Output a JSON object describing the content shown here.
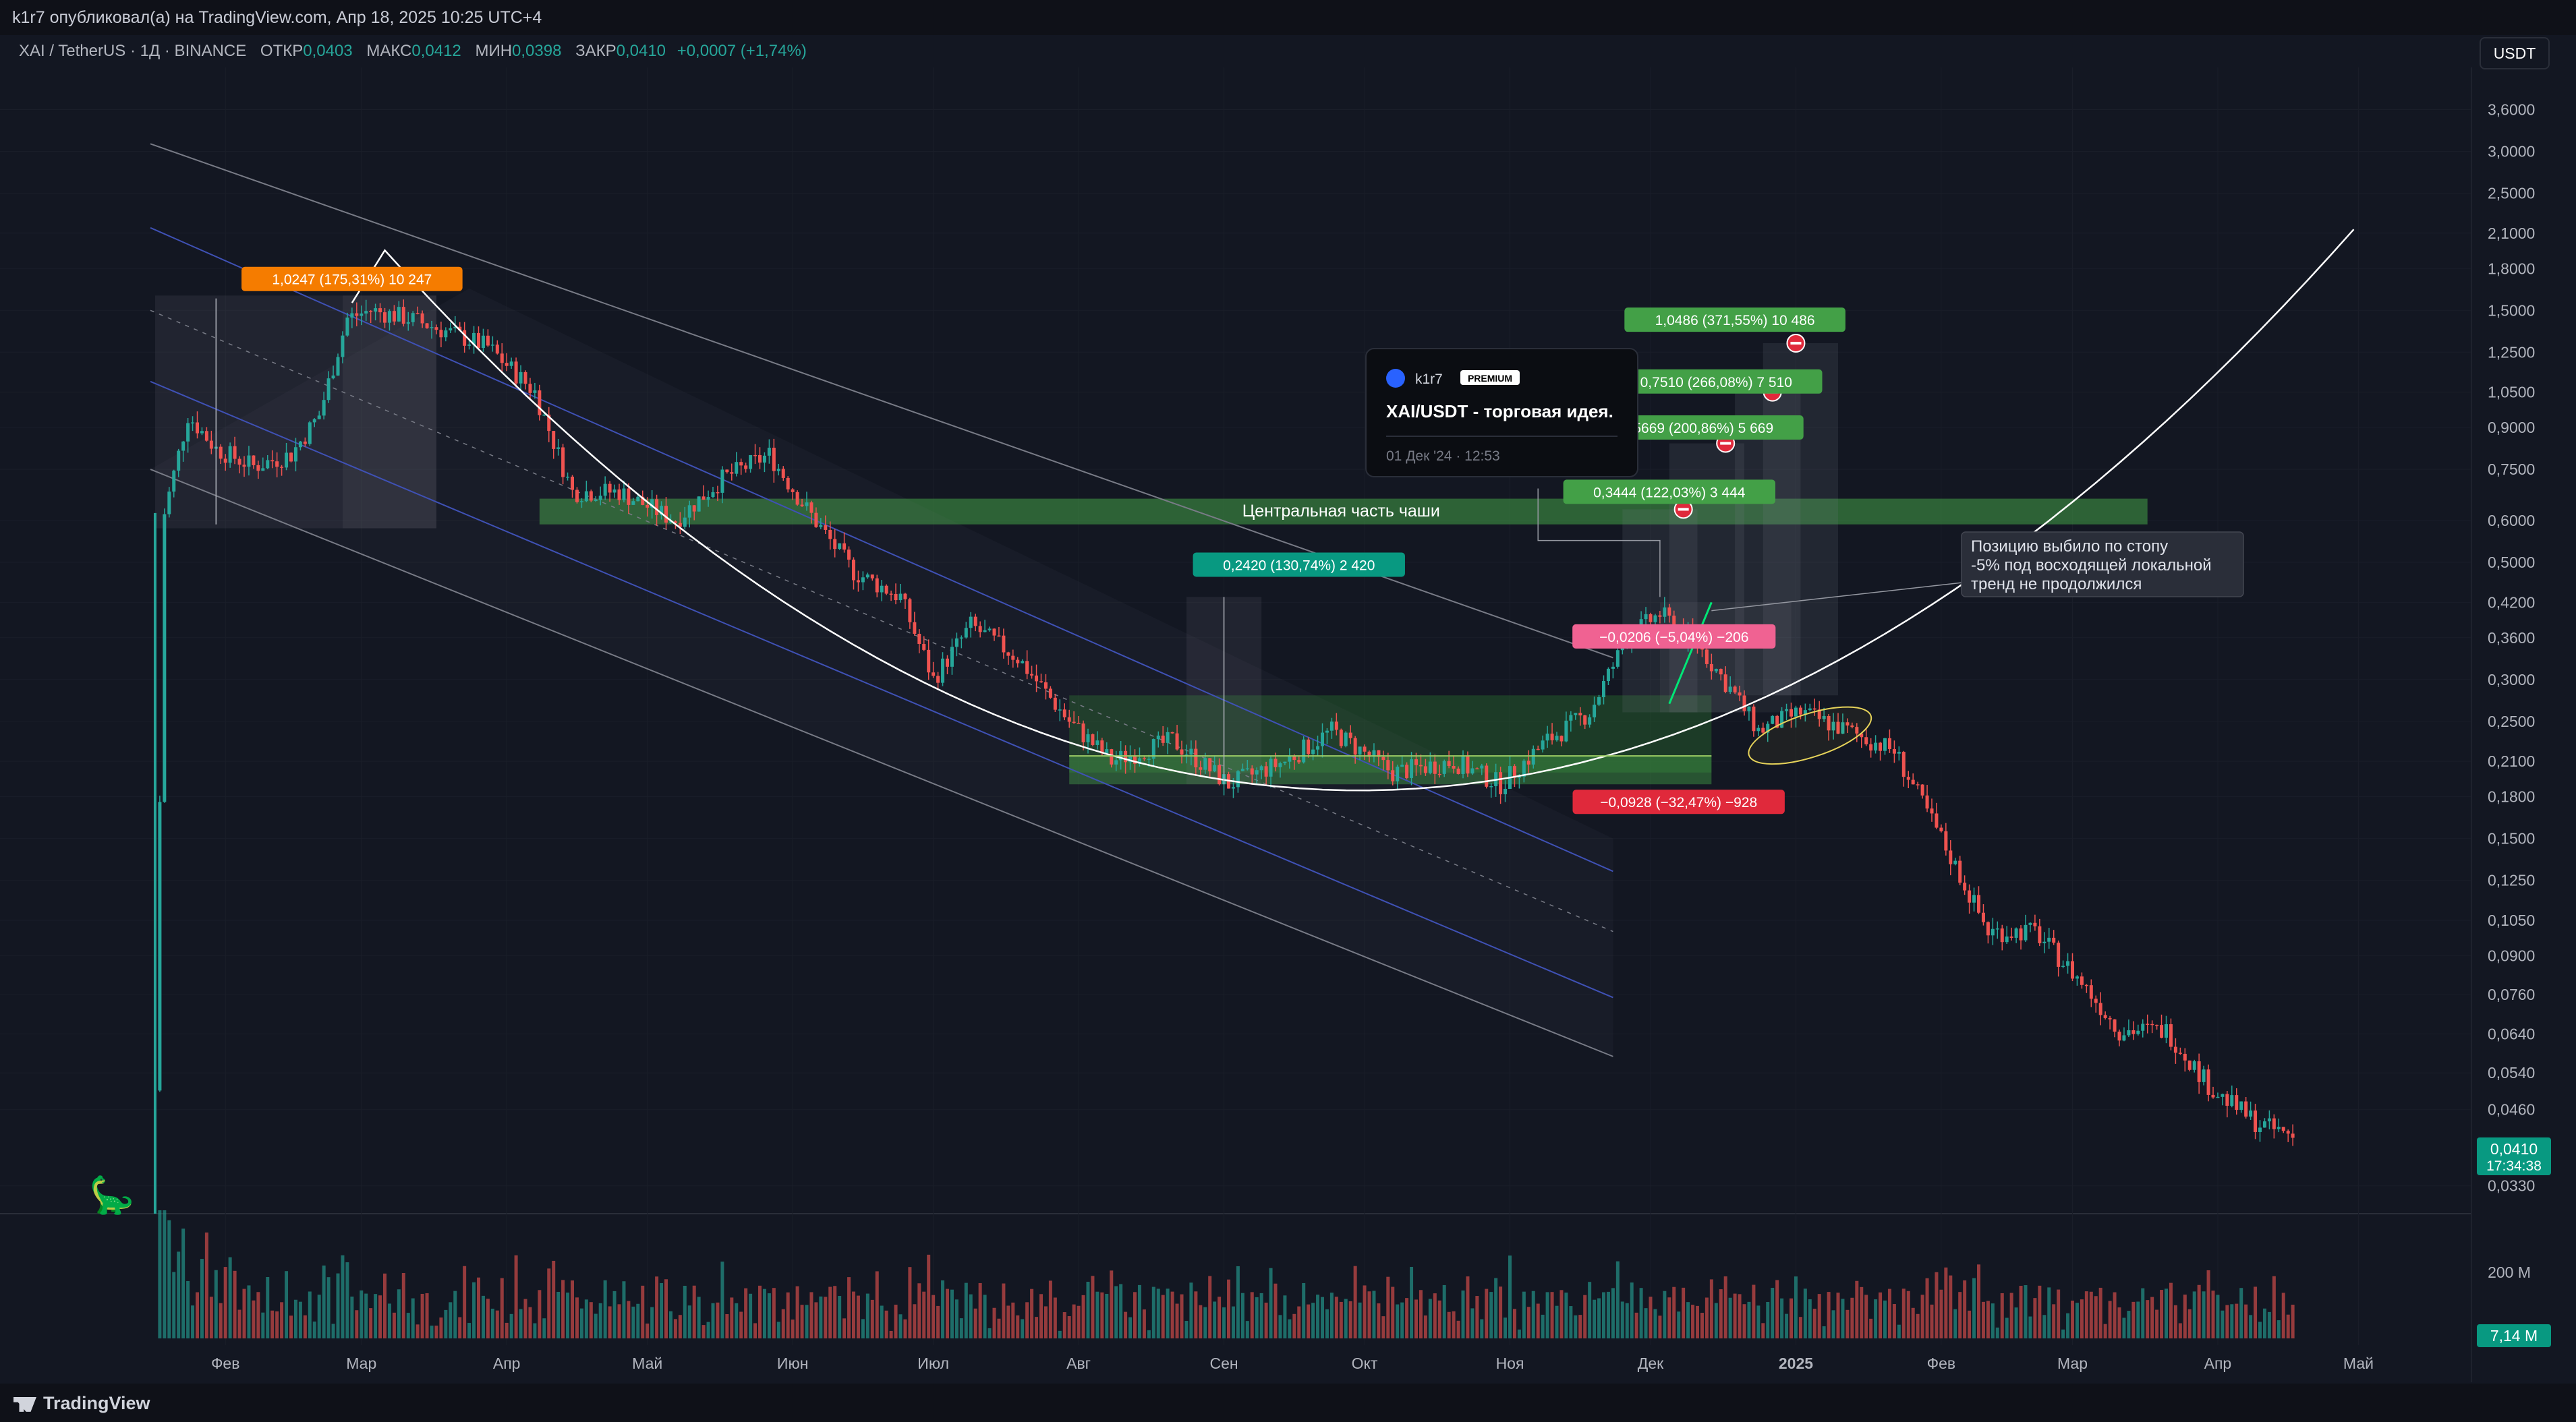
{
  "header": {
    "publish": "k1r7 опубликовал(а) на TradingView.com, Апр 18, 2025 10:25 UTC+4"
  },
  "symbol": {
    "name": "XAI / TetherUS · 1Д · BINANCE",
    "o_label": "ОТКР",
    "o": "0,0403",
    "h_label": "МАКС",
    "h": "0,0412",
    "l_label": "МИН",
    "l": "0,0398",
    "c_label": "ЗАКР",
    "c": "0,0410",
    "chg": "+0,0007 (+1,74%)"
  },
  "currency_button": "USDT",
  "footer": {
    "brand": "TradingView"
  },
  "colors": {
    "bg": "#131722",
    "up": "#26a69a",
    "down": "#ef5350",
    "green_label": "#43a047",
    "red_label": "#e0293b",
    "orange_label": "#f57c00",
    "teal_label": "#089981",
    "zone": "#2e7d32"
  },
  "idea_card": {
    "author": "k1r7",
    "badge": "PREMIUM",
    "title": "XAI/USDT - торговая идея.",
    "date": "01 Дек '24 · 12:53"
  },
  "note": {
    "line1": "Позицию выбило по стопу",
    "line2": "-5% под восходящей локальной",
    "line3": "тренд не продолжился"
  },
  "zone_label": "Центральная часть чаши",
  "measure_labels": [
    {
      "text": "1,0247 (175,31%) 10 247",
      "color": "orange"
    },
    {
      "text": "0,2420 (130,74%) 2 420",
      "color": "teal"
    },
    {
      "text": "−0,0928 (−32,47%) −928",
      "color": "red"
    },
    {
      "text": "−0,0206 (−5,04%) −206",
      "color": "pink"
    },
    {
      "text": "0,3444 (122,03%) 3 444",
      "color": "green"
    },
    {
      "text": "0,5669 (200,86%) 5 669",
      "color": "green"
    },
    {
      "text": "0,7510 (266,08%) 7 510",
      "color": "green"
    },
    {
      "text": "1,0486 (371,55%) 10 486",
      "color": "green"
    }
  ],
  "price_badge": {
    "price": "0,0410",
    "countdown": "17:34:38"
  },
  "volume_badge": "7,14 M",
  "volume_tick": "200 M",
  "chart_data": {
    "type": "candlestick",
    "scale": "log",
    "ylim": [
      0.031,
      4.2
    ],
    "y_ticks": [
      "3,6000",
      "3,0000",
      "2,5000",
      "2,1000",
      "1,8000",
      "1,5000",
      "1,2500",
      "1,0500",
      "0,9000",
      "0,7500",
      "0,6000",
      "0,5000",
      "0,4200",
      "0,3600",
      "0,3000",
      "0,2500",
      "0,2100",
      "0,1800",
      "0,1500",
      "0,1250",
      "0,1050",
      "0,0900",
      "0,0760",
      "0,0640",
      "0,0540",
      "0,0460",
      "0,0330"
    ],
    "y_tick_values": [
      3.6,
      3.0,
      2.5,
      2.1,
      1.8,
      1.5,
      1.25,
      1.05,
      0.9,
      0.75,
      0.6,
      0.5,
      0.42,
      0.36,
      0.3,
      0.25,
      0.21,
      0.18,
      0.15,
      0.125,
      0.105,
      0.09,
      0.076,
      0.064,
      0.054,
      0.046,
      0.033
    ],
    "x_ticks": [
      "Фев",
      "Мар",
      "Апр",
      "Май",
      "Июн",
      "Июл",
      "Авг",
      "Сен",
      "Окт",
      "Ноя",
      "Дек",
      "2025",
      "Фев",
      "Мар",
      "Апр",
      "Май"
    ],
    "x_tick_days": [
      16,
      45,
      76,
      106,
      137,
      167,
      198,
      229,
      259,
      290,
      320,
      351,
      382,
      410,
      441,
      471
    ],
    "price_path": [
      [
        1,
        0.05
      ],
      [
        3,
        0.62
      ],
      [
        8,
        0.95
      ],
      [
        14,
        0.82
      ],
      [
        22,
        0.76
      ],
      [
        30,
        0.8
      ],
      [
        36,
        0.95
      ],
      [
        42,
        1.45
      ],
      [
        47,
        1.5
      ],
      [
        55,
        1.45
      ],
      [
        62,
        1.38
      ],
      [
        72,
        1.28
      ],
      [
        82,
        1.05
      ],
      [
        90,
        0.68
      ],
      [
        100,
        0.68
      ],
      [
        112,
        0.6
      ],
      [
        122,
        0.72
      ],
      [
        132,
        0.8
      ],
      [
        140,
        0.63
      ],
      [
        150,
        0.48
      ],
      [
        160,
        0.43
      ],
      [
        167,
        0.3
      ],
      [
        175,
        0.38
      ],
      [
        185,
        0.33
      ],
      [
        196,
        0.25
      ],
      [
        205,
        0.21
      ],
      [
        218,
        0.23
      ],
      [
        230,
        0.19
      ],
      [
        242,
        0.21
      ],
      [
        252,
        0.24
      ],
      [
        265,
        0.2
      ],
      [
        278,
        0.21
      ],
      [
        288,
        0.19
      ],
      [
        298,
        0.23
      ],
      [
        307,
        0.26
      ],
      [
        315,
        0.36
      ],
      [
        322,
        0.4
      ],
      [
        330,
        0.35
      ],
      [
        338,
        0.28
      ],
      [
        343,
        0.24
      ],
      [
        352,
        0.26
      ],
      [
        362,
        0.24
      ],
      [
        372,
        0.22
      ],
      [
        382,
        0.15
      ],
      [
        392,
        0.1
      ],
      [
        402,
        0.1
      ],
      [
        412,
        0.08
      ],
      [
        420,
        0.065
      ],
      [
        430,
        0.065
      ],
      [
        440,
        0.05
      ],
      [
        450,
        0.043
      ],
      [
        457,
        0.041
      ]
    ],
    "volume_ylim": [
      0,
      260
    ],
    "volume_unit": "M"
  }
}
